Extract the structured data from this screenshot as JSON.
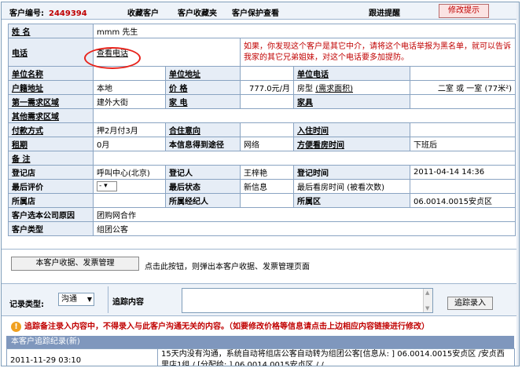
{
  "header": {
    "customer_id_label": "客户编号:",
    "customer_id": "2449394",
    "links": [
      "收藏客户",
      "客户收藏夹",
      "客户保护查看",
      "跟进提醒"
    ],
    "notice_button": "修改提示"
  },
  "customer": {
    "name_label": "姓  名",
    "name": "mmm 先生",
    "phone_label": "电话",
    "phone_link": "查看电话",
    "phone_warning": "如果，你发现这个客户是其它中介，请将这个电话举报为黑名单，就可以告诉我家的其它兄弟姐妹，对这个电话要多加提防。",
    "unit_name_label": "单位名称",
    "unit_address_label": "单位地址",
    "unit_phone_label": "单位电话",
    "household_label": "户籍地址",
    "household": "本地",
    "price_label": "价  格",
    "price": "777.0元/月",
    "room_type_label": "房型",
    "room_area_link": "(需求面积)",
    "room_type": "二室 或 一室 (77米²)",
    "area1_label": "第一需求区域",
    "area1": "建外大街",
    "appliance_label": "家  电",
    "furniture_label": "家具",
    "other_area_label": "其他需求区域",
    "payment_label": "付款方式",
    "payment": "押2月付3月",
    "rent_intent_label": "合住意向",
    "move_in_label": "入住时间",
    "lease_label": "租期",
    "lease": "0月",
    "source_label": "本信息得到途径",
    "source": "网络",
    "viewing_time_label": "方便看房时间",
    "viewing_time": "下班后",
    "remark_label": "备  注",
    "reg_store_label": "登记店",
    "reg_store": "呼叫中心(北京)",
    "registrar_label": "登记人",
    "registrar": "王梓艳",
    "reg_time_label": "登记时间",
    "reg_time": "2011-04-14 14:36",
    "last_eval_label": "最后评价",
    "last_eval": "-",
    "last_status_label": "最后状态",
    "last_status": "新信息",
    "last_view_label": "最后看房时间",
    "last_view_count": "(被看次数)",
    "store_label": "所属店",
    "broker_label": "所属经纪人",
    "district_label": "所属区",
    "district": "06.0014.0015安贞区",
    "reason_label": "客户选本公司原因",
    "reason": "团购网合作",
    "type_label": "客户类型",
    "type": "组团公客"
  },
  "receipt": {
    "button": "本客户收据、发票管理",
    "hint": "点击此按钮，则弹出本客户收据、发票管理页面"
  },
  "followup": {
    "type_label": "记录类型:",
    "type_value": "沟通",
    "content_label": "追踪内容",
    "submit": "追踪录入",
    "warning": "追踪备注录入内容中，不得录入与此客户沟通无关的内容。（如要修改价格等信息请点击上边相应内容链接进行修改）"
  },
  "history": {
    "title": "本客户追踪纪录(新)",
    "rows": [
      {
        "date": "2011-11-29 03:10",
        "text": "15天内没有沟通，系统自动将组店公客自动转为组团公客[信息从: ] 06.0014.0015安贞区 /安贞西里店1组 / [分配给: ] 06.0014.0015安贞区 / /"
      }
    ]
  },
  "colors": {
    "accent_red": "#c00000",
    "label_bg": "#e6edf6",
    "border": "#8aa4c2",
    "history_bar": "#7f97bd"
  }
}
